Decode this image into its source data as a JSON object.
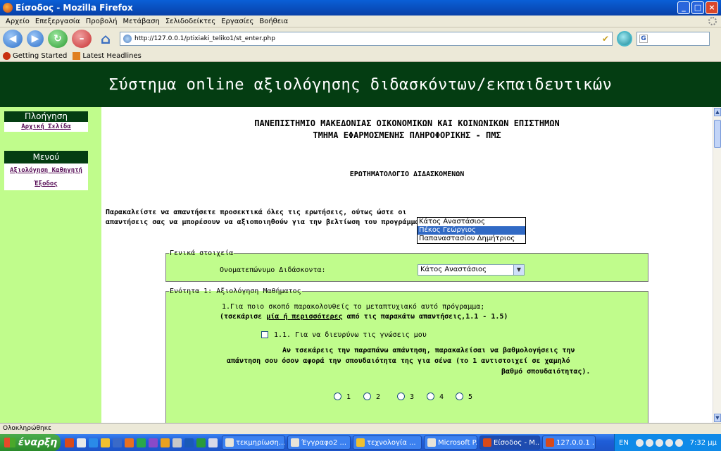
{
  "window": {
    "title": "Είσοδος - Mozilla Firefox"
  },
  "menu": [
    "Αρχείο",
    "Επεξεργασία",
    "Προβολή",
    "Μετάβαση",
    "Σελιδοδείκτες",
    "Εργασίες",
    "Βοήθεια"
  ],
  "address": {
    "url": "http://127.0.0.1/ptixiaki_teliko1/st_enter.php"
  },
  "bookmarks": [
    "Getting Started",
    "Latest Headlines"
  ],
  "banner": {
    "title": "Σύστημα online αξιολόγησης διδασκόντων/εκπαιδευτικών"
  },
  "sidebar": {
    "nav_heading": "Πλοήγηση",
    "nav_items": [
      "Αρχική Σελίδα"
    ],
    "menu_heading": "Μενού",
    "menu_items": [
      "Αξιολόγηση Καθηγητή",
      "Έξοδος"
    ]
  },
  "main": {
    "university": "ΠΑΝΕΠΙΣΤΗΜΙΟ ΜΑΚΕΔΟΝΙΑΣ ΟΙΚΟΝΟΜΙΚΩΝ ΚΑΙ ΚΟΙΝΩΝΙΚΩΝ ΕΠΙΣΤΗΜΩΝ",
    "department": "ΤΜΗΜΑ ΕΦΑΡΜΟΣΜΕΝΗΣ ΠΛΗΡΟΦΟΡΙΚΗΣ - ΠΜΣ",
    "form_title": "ΕΡΩΤΗΜΑΤΟΛΟΓΙΟ ΔΙΔΑΣΚΟΜΕΝΩΝ",
    "instructions_line1": "Παρακαλείστε να απαντήσετε προσεκτικά όλες τις ερωτήσεις, ούτως ώστε οι",
    "instructions_line2": "απαντήσεις σας να μπορέσουν να αξιοποιηθούν για την βελτίωση του προγράμματος.",
    "general": {
      "legend": "Γενικά στοιχεία",
      "teacher_label": "Ονοματεπώνυμο Διδάσκοντα:",
      "teacher_selected": "Κάτος Αναστάσιος",
      "teacher_options": [
        "Κάτος Αναστάσιος",
        "Πέκος Γεώργιος",
        "Παπαναστασίου Δημήτριος"
      ]
    },
    "unit1": {
      "legend": "Ενότητα 1: Αξιολόγηση Μαθήματος",
      "question": "1.Για ποιο σκοπό παρακολουθείς το μεταπτυχιακό αυτό πρόγραμμα;",
      "hint_pre": "(τσεκάρισε ",
      "hint_link": "μία ή περισσότερες",
      "hint_post": " από τις παρακάτω απαντήσεις,1.1 - 1.5)",
      "option1": "1.1. Για να διευρύνω τις γνώσεις μου",
      "rate_line1": "Αν τσεκάρεις την παραπάνω απάντηση, παρακαλείσαι να βαθμολογήσεις την",
      "rate_line2": "απάντηση σου όσον αφορά την σπουδαιότητα της για σένα (το 1 αντιστοιχεί σε χαμηλό",
      "rate_line3": "βαθμό σπουδαιότητας).",
      "scale": [
        "1",
        "2",
        "3",
        "4",
        "5"
      ]
    }
  },
  "status": {
    "text": "Ολοκληρώθηκε"
  },
  "taskbar": {
    "start": "έναρξη",
    "tasks": [
      "τεκμηρίωση...",
      "Έγγραφο2 ...",
      "τεχνολογία ...",
      "Microsoft P...",
      "Είσοδος - M...",
      "127.0.0.1 ..."
    ],
    "lang": "EN",
    "clock": "7:32 μμ"
  }
}
